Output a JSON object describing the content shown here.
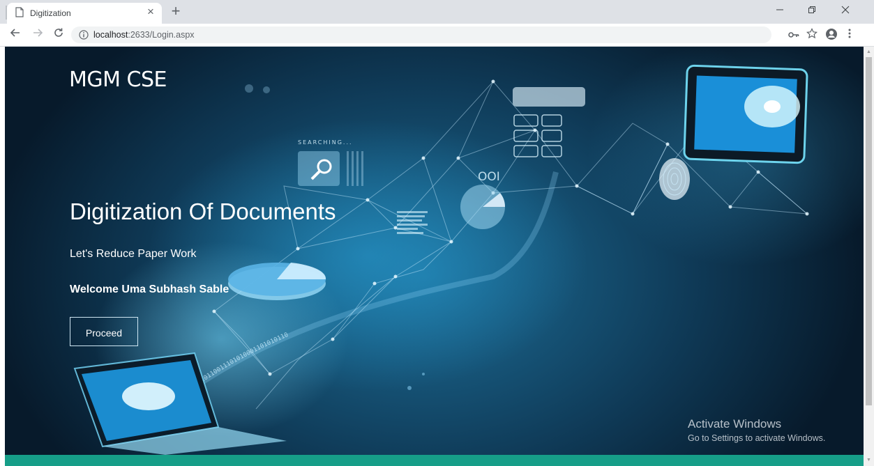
{
  "browser": {
    "tab_title": "Digitization",
    "url_host": "localhost",
    "url_rest": ":2633/Login.aspx",
    "icons": {
      "page": "page-icon",
      "close_tab": "close-icon",
      "new_tab": "plus-icon",
      "minimize": "minimize-icon",
      "restore": "restore-icon",
      "close_window": "close-icon",
      "back": "back-arrow-icon",
      "forward": "forward-arrow-icon",
      "reload": "reload-icon",
      "site_info": "info-icon",
      "password": "key-icon",
      "bookmark": "star-icon",
      "profile": "account-icon",
      "menu": "more-vert-icon"
    }
  },
  "page": {
    "brand": "MGM CSE",
    "headline": "Digitization Of Documents",
    "tagline": "Let's Reduce Paper Work",
    "welcome": "Welcome Uma Subhash Sable",
    "proceed_label": "Proceed",
    "hero_art_label": "SEARCHING...",
    "binary_stream": "10110100011010110011101010001101010110",
    "footer_color": "#169e88"
  },
  "watermark": {
    "line1": "Activate Windows",
    "line2": "Go to Settings to activate Windows."
  }
}
